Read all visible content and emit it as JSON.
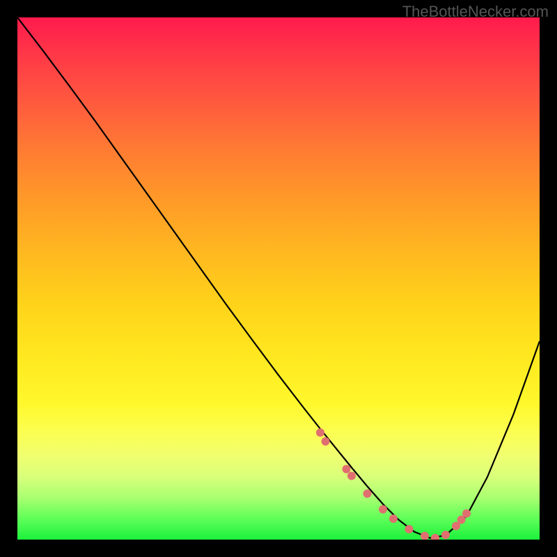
{
  "watermark": "TheBottleNecker.com",
  "chart_data": {
    "type": "line",
    "title": "",
    "xlabel": "",
    "ylabel": "",
    "xlim": [
      0,
      100
    ],
    "ylim": [
      0,
      100
    ],
    "gradient_stops": [
      {
        "pos": 0,
        "color": "#ff1a4d"
      },
      {
        "pos": 50,
        "color": "#ffb820"
      },
      {
        "pos": 80,
        "color": "#fbff55"
      },
      {
        "pos": 100,
        "color": "#1cf03c"
      }
    ],
    "series": [
      {
        "name": "bottleneck-curve",
        "color": "#000000",
        "x": [
          0,
          5,
          10,
          15,
          20,
          25,
          30,
          35,
          40,
          45,
          50,
          55,
          58,
          61,
          64,
          67,
          70,
          73,
          76,
          79,
          82,
          86,
          90,
          95,
          100
        ],
        "y": [
          100,
          93.5,
          86.8,
          80,
          73,
          66,
          59,
          52,
          45,
          38.2,
          31.5,
          25,
          21.2,
          17.5,
          13.8,
          10.2,
          6.8,
          3.8,
          1.5,
          0.3,
          0.8,
          4.5,
          12,
          24,
          38
        ]
      }
    ],
    "markers": {
      "name": "transition-zone-dots",
      "color": "#e07070",
      "radius": 6,
      "points_xy": [
        [
          58,
          20.5
        ],
        [
          59,
          18.8
        ],
        [
          63,
          13.5
        ],
        [
          64,
          12.2
        ],
        [
          67,
          8.8
        ],
        [
          70,
          5.8
        ],
        [
          72,
          4.0
        ],
        [
          75,
          2.0
        ],
        [
          78,
          0.7
        ],
        [
          80,
          0.3
        ],
        [
          82,
          0.9
        ],
        [
          84,
          2.6
        ],
        [
          85,
          3.8
        ],
        [
          86,
          5.0
        ]
      ]
    }
  }
}
